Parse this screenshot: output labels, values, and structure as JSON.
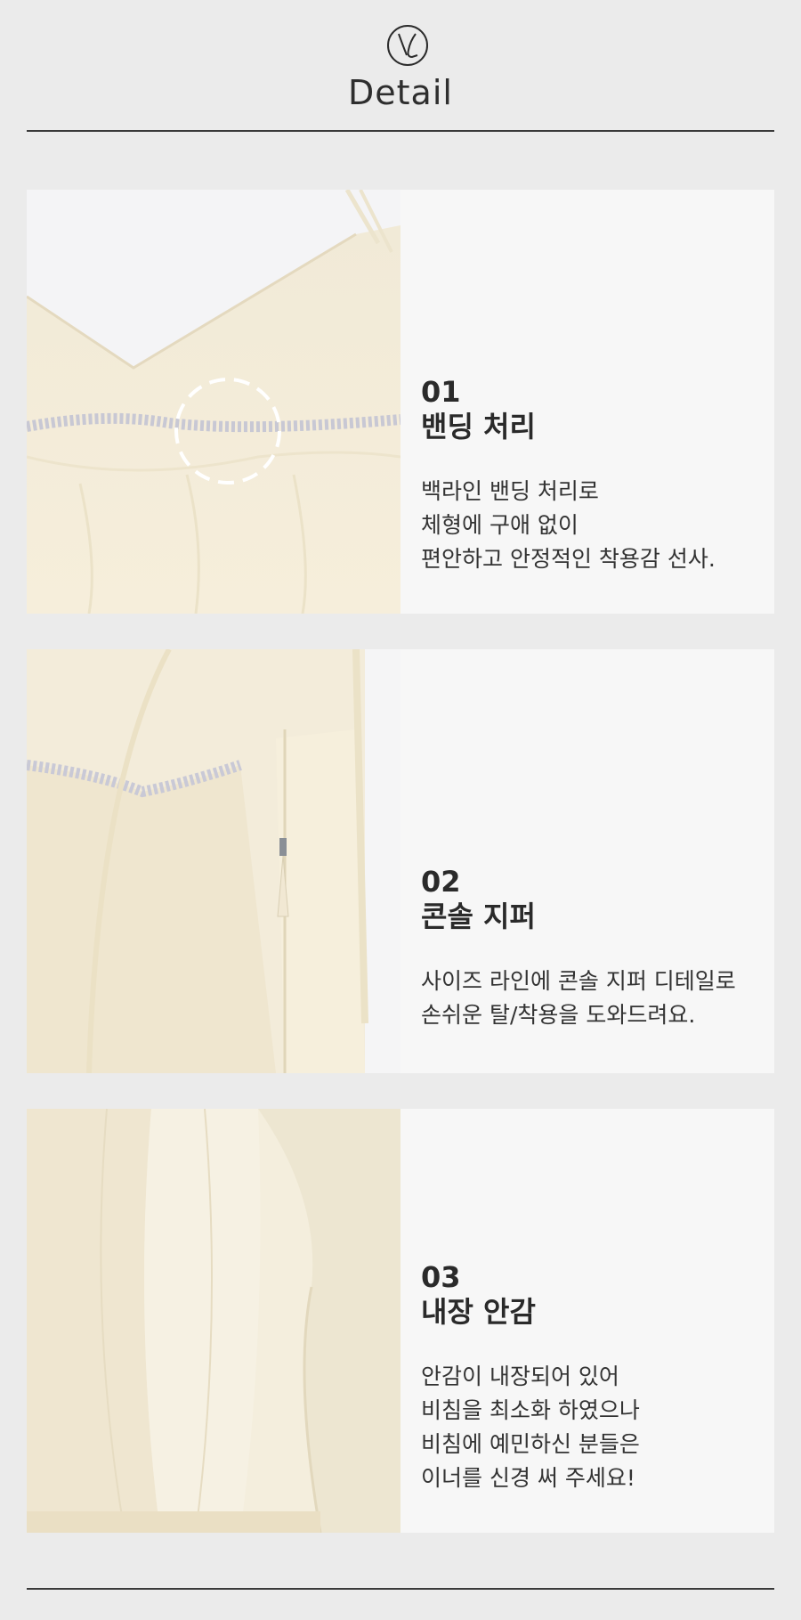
{
  "header": {
    "title": "Detail"
  },
  "sections": [
    {
      "num": "01",
      "title": "밴딩 처리",
      "desc": "백라인 밴딩 처리로\n체형에 구애 없이\n편안하고 안정적인 착용감 선사."
    },
    {
      "num": "02",
      "title": "콘솔 지퍼",
      "desc": "사이즈 라인에 콘솔 지퍼 디테일로\n손쉬운 탈/착용을 도와드려요."
    },
    {
      "num": "03",
      "title": "내장 안감",
      "desc": "안감이 내장되어 있어\n비침을 최소화 하였으나\n비침에 예민하신 분들은\n이너를 신경 써 주세요!"
    }
  ]
}
